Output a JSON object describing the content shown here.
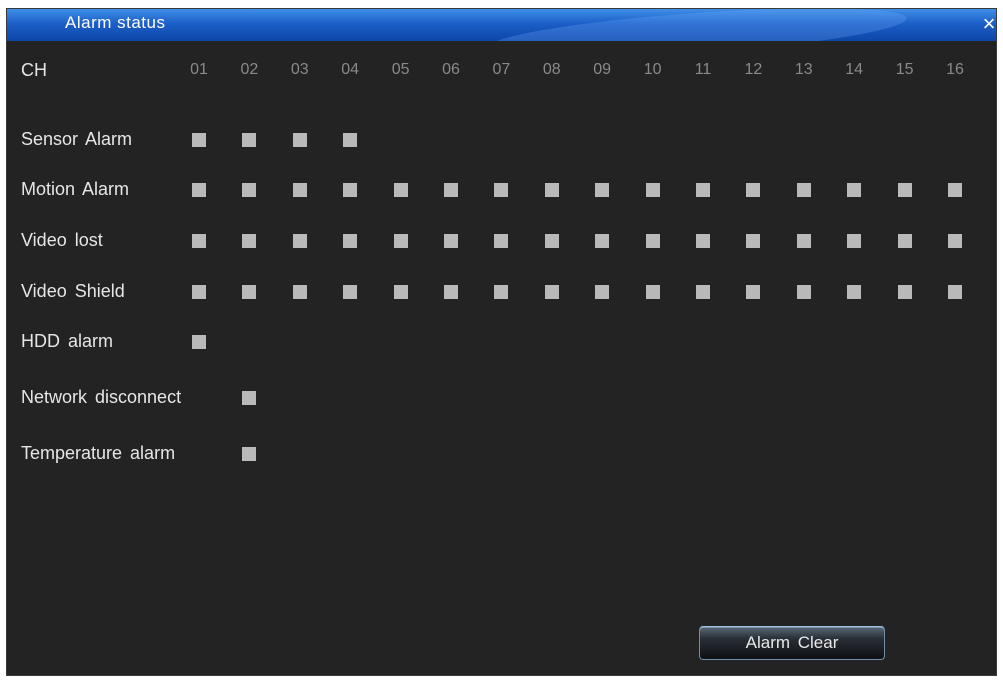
{
  "window": {
    "title": "Alarm status",
    "close_label": "×"
  },
  "header": {
    "label": "CH",
    "channels": [
      "01",
      "02",
      "03",
      "04",
      "05",
      "06",
      "07",
      "08",
      "09",
      "10",
      "11",
      "12",
      "13",
      "14",
      "15",
      "16"
    ]
  },
  "rows": [
    {
      "label": "Sensor Alarm",
      "active": [
        1,
        1,
        1,
        1,
        0,
        0,
        0,
        0,
        0,
        0,
        0,
        0,
        0,
        0,
        0,
        0
      ]
    },
    {
      "label": "Motion Alarm",
      "active": [
        1,
        1,
        1,
        1,
        1,
        1,
        1,
        1,
        1,
        1,
        1,
        1,
        1,
        1,
        1,
        1
      ]
    },
    {
      "label": "Video lost",
      "active": [
        1,
        1,
        1,
        1,
        1,
        1,
        1,
        1,
        1,
        1,
        1,
        1,
        1,
        1,
        1,
        1
      ]
    },
    {
      "label": "Video Shield",
      "active": [
        1,
        1,
        1,
        1,
        1,
        1,
        1,
        1,
        1,
        1,
        1,
        1,
        1,
        1,
        1,
        1
      ]
    },
    {
      "label": "HDD alarm",
      "active": [
        1,
        0,
        0,
        0,
        0,
        0,
        0,
        0,
        0,
        0,
        0,
        0,
        0,
        0,
        0,
        0
      ]
    },
    {
      "label": "Network disconnect",
      "active": [
        0,
        1,
        0,
        0,
        0,
        0,
        0,
        0,
        0,
        0,
        0,
        0,
        0,
        0,
        0,
        0
      ]
    },
    {
      "label": "Temperature alarm",
      "active": [
        0,
        1,
        0,
        0,
        0,
        0,
        0,
        0,
        0,
        0,
        0,
        0,
        0,
        0,
        0,
        0
      ]
    }
  ],
  "footer": {
    "clear_label": "Alarm Clear"
  },
  "colors": {
    "background": "#232323",
    "indicator": "#b9b9b9",
    "titlebar": "#1c5fc8"
  }
}
